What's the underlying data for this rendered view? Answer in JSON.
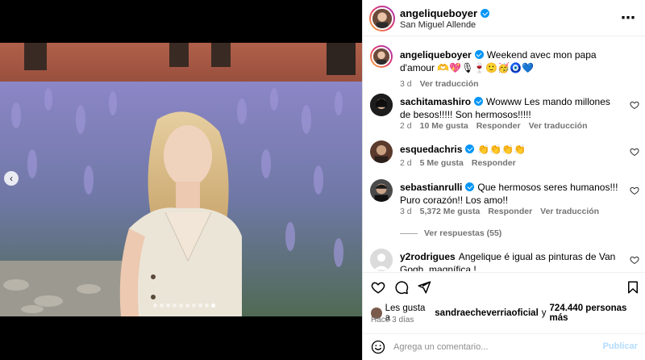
{
  "post": {
    "username": "angeliqueboyer",
    "location": "San Miguel Allende",
    "carousel_count": 10,
    "carousel_active": 9
  },
  "comments": [
    {
      "username": "angeliqueboyer",
      "text": "Weekend avec mon papa d'amour 🫶💖🎙🍷🙂🥳🧿💙",
      "time": "3 d",
      "action1": "Ver traducción"
    },
    {
      "username": "sachitamashiro",
      "text": "Wowww Les mando millones de besos!!!!! Son hermosos!!!!!",
      "time": "2 d",
      "likes": "10 Me gusta",
      "action1": "Responder",
      "action2": "Ver traducción"
    },
    {
      "username": "esquedachris",
      "text": "👏👏👏👏",
      "time": "2 d",
      "likes": "5 Me gusta",
      "action1": "Responder"
    },
    {
      "username": "sebastianrulli",
      "text": "Que hermosos seres humanos!!! Puro corazón!! Los amo!!",
      "time": "3 d",
      "likes": "5,372 Me gusta",
      "action1": "Responder",
      "action2": "Ver traducción"
    },
    {
      "username": "y2rodrigues",
      "text": "Angelique é igual as pinturas de Van Gogh, magnífica !"
    }
  ],
  "replies_label": "Ver respuestas (55)",
  "likes": {
    "prefix": "Les gusta a",
    "user": "sandraecheverriaoficial",
    "connector": "y",
    "count": "724.440 personas más"
  },
  "timestamp": "Hace 3 días",
  "composer": {
    "placeholder": "Agrega un comentario...",
    "post_label": "Publicar"
  },
  "icons": {
    "more": "more-options-icon",
    "like": "heart-icon",
    "comment": "comment-icon",
    "share": "share-icon",
    "save": "bookmark-icon",
    "emoji": "emoji-icon",
    "verified": "verified-badge-icon",
    "prev": "chevron-left-icon"
  },
  "colors": {
    "accent": "#0095f6",
    "muted": "#737373",
    "post_disabled": "#b3dbff"
  }
}
